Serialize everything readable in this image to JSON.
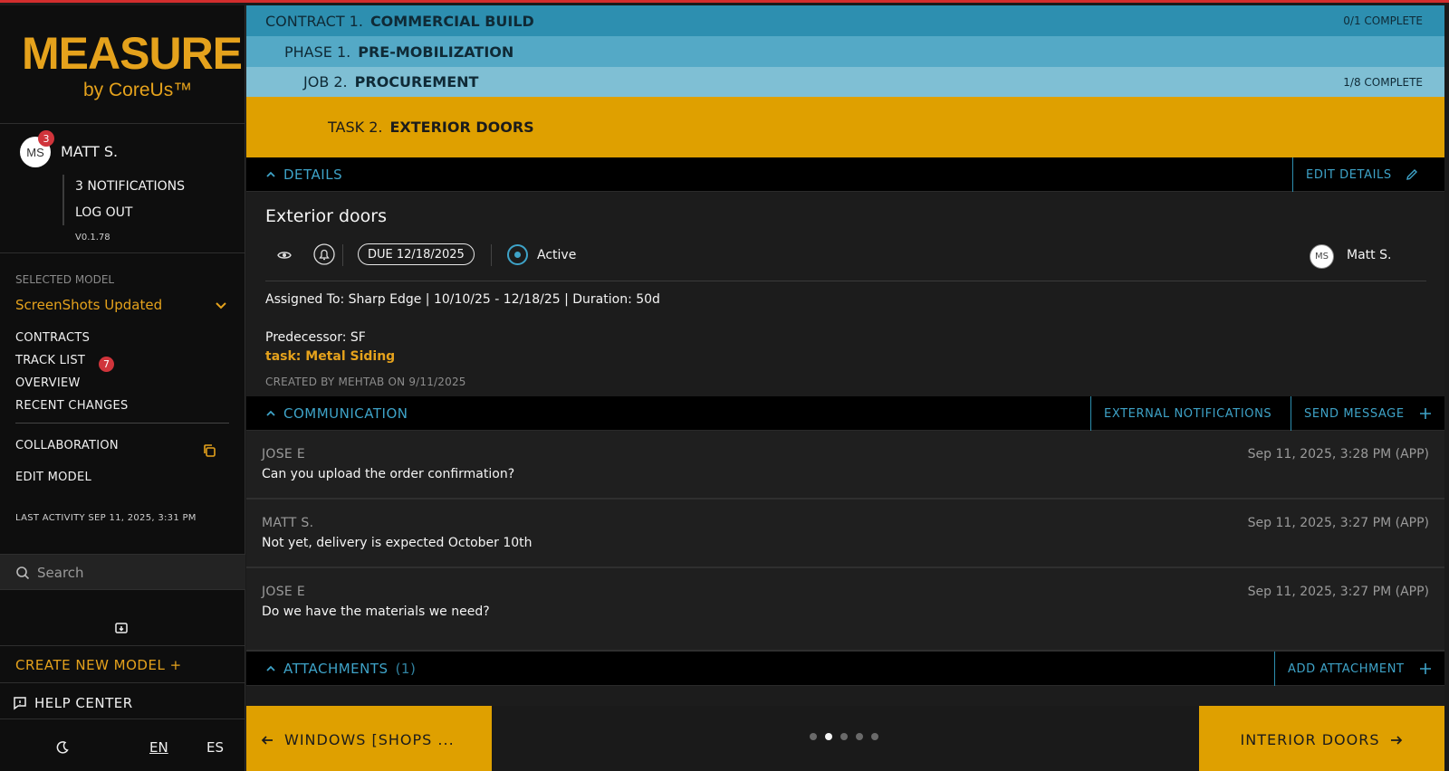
{
  "brand": {
    "word": "MEASURE",
    "byline": "by CoreUs™"
  },
  "user": {
    "initials": "MS",
    "badge": "3",
    "name": "MATT S.",
    "menu": [
      "3 NOTIFICATIONS",
      "LOG OUT"
    ],
    "version": "V0.1.78"
  },
  "model": {
    "label": "SELECTED MODEL",
    "value": "ScreenShots Updated"
  },
  "nav": {
    "contracts": "CONTRACTS",
    "track_list": "TRACK LIST",
    "track_badge": "7",
    "overview": "OVERVIEW",
    "recent_changes": "RECENT CHANGES",
    "collaboration": "COLLABORATION",
    "edit_model": "EDIT MODEL"
  },
  "last_activity": "LAST ACTIVITY SEP 11, 2025, 3:31 PM",
  "search": {
    "placeholder": "Search"
  },
  "create_model": "CREATE NEW MODEL +",
  "help_center": "HELP CENTER",
  "languages": {
    "en": "EN",
    "es": "ES"
  },
  "breadcrumb": {
    "contract": {
      "prefix": "CONTRACT 1.",
      "name": "COMMERCIAL BUILD",
      "status": "0/1 COMPLETE"
    },
    "phase": {
      "prefix": "PHASE 1.",
      "name": "PRE-MOBILIZATION"
    },
    "job": {
      "prefix": "JOB 2.",
      "name": "PROCUREMENT",
      "status": "1/8 COMPLETE"
    },
    "task": {
      "prefix": "TASK 2.",
      "name": "EXTERIOR DOORS"
    }
  },
  "details": {
    "header": "DETAILS",
    "edit_label": "EDIT DETAILS",
    "task_name": "Exterior doors",
    "due": "DUE 12/18/2025",
    "status": "Active",
    "assignee_initials": "MS",
    "assignee": "Matt S.",
    "assigned_line": "Assigned To: Sharp Edge | 10/10/25 - 12/18/25 | Duration: 50d",
    "predecessor": "Predecessor: SF",
    "predecessor_task": "task: Metal Siding",
    "created": "CREATED BY MEHTAB ON 9/11/2025"
  },
  "communication": {
    "header": "COMMUNICATION",
    "external_label": "EXTERNAL NOTIFICATIONS",
    "send_label": "SEND MESSAGE",
    "messages": [
      {
        "author": "JOSE E",
        "time": "Sep 11, 2025, 3:28 PM (APP)",
        "text": "Can you upload the order confirmation?"
      },
      {
        "author": "MATT S.",
        "time": "Sep 11, 2025, 3:27 PM (APP)",
        "text": "Not yet, delivery is expected October 10th"
      },
      {
        "author": "JOSE E",
        "time": "Sep 11, 2025, 3:27 PM (APP)",
        "text": "Do we have the materials we need?"
      }
    ]
  },
  "attachments": {
    "header": "ATTACHMENTS",
    "count": "(1)",
    "add_label": "ADD ATTACHMENT"
  },
  "pager": {
    "prev": "WINDOWS [SHOPS ...",
    "next": "INTERIOR DOORS",
    "total": 5,
    "active": 2
  },
  "colors": {
    "accent_gold": "#dfa000",
    "accent_blue": "#3ea3c8",
    "contract_bar": "#2d8fb0",
    "phase_bar": "#54a9c6",
    "job_bar": "#7fbfd4",
    "badge_red": "#d0343b"
  }
}
